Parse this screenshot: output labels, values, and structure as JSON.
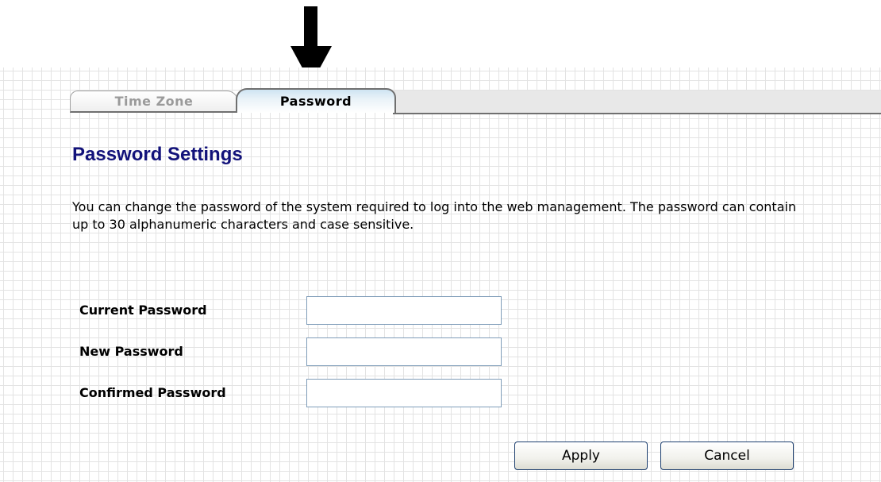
{
  "tabs": [
    {
      "label": "Time Zone",
      "active": false
    },
    {
      "label": "Password",
      "active": true
    }
  ],
  "page": {
    "title": "Password Settings",
    "description": "You can change the password of the system required to log into the web management. The password can contain up to 30 alphanumeric characters and case sensitive."
  },
  "form": {
    "current_password": {
      "label": "Current Password",
      "value": ""
    },
    "new_password": {
      "label": "New Password",
      "value": ""
    },
    "confirmed_password": {
      "label": "Confirmed Password",
      "value": ""
    }
  },
  "buttons": {
    "apply": "Apply",
    "cancel": "Cancel"
  },
  "colors": {
    "heading": "#12127a",
    "active_tab": "#cfe4f2",
    "grid": "#e3e3e3",
    "input_border": "#7f9db9",
    "button_border": "#1c3e6e"
  },
  "icons": {
    "callout": "down-arrow-icon"
  }
}
